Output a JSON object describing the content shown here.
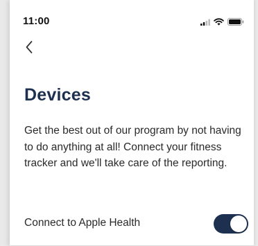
{
  "status_bar": {
    "time": "11:00",
    "icons": [
      "cellular-signal-icon",
      "wifi-icon",
      "battery-icon"
    ]
  },
  "nav": {
    "back_icon": "chevron-left-icon"
  },
  "page": {
    "title": "Devices",
    "description": "Get the best out of our program by not having to do anything at all! Connect your fitness tracker and we'll take care of the reporting."
  },
  "settings": {
    "apple_health": {
      "label": "Connect to Apple Health",
      "enabled": true
    }
  },
  "colors": {
    "accent": "#1d3050",
    "text": "#2a2a2a",
    "background": "#ffffff"
  }
}
